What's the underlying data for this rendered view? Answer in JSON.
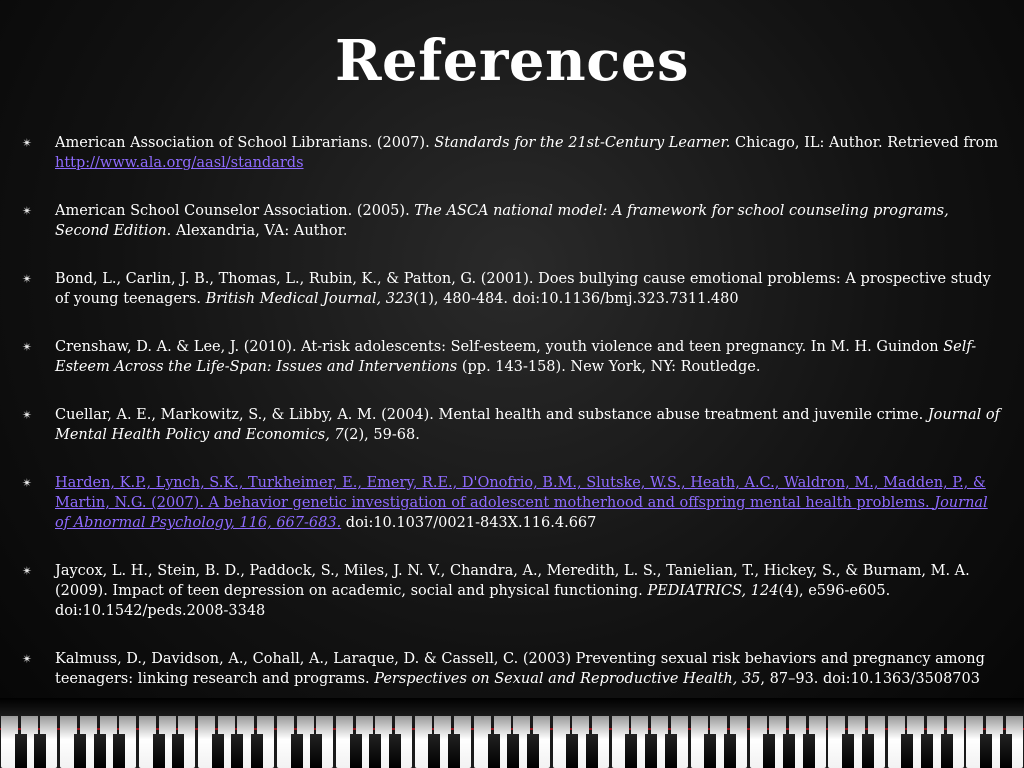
{
  "title": "References",
  "references": [
    {
      "segments": [
        {
          "text": "American Association of School Librarians. (2007). "
        },
        {
          "text": "Standards for the 21st-Century Learner.",
          "italic": true
        },
        {
          "text": " Chicago, IL: Author. Retrieved from "
        },
        {
          "text": "http://www.ala.org/aasl/standards",
          "link": true
        }
      ]
    },
    {
      "segments": [
        {
          "text": "American School Counselor Association. (2005). "
        },
        {
          "text": "The ASCA national model: A framework for school counseling programs, Second Edition",
          "italic": true
        },
        {
          "text": ". Alexandria, VA: Author."
        }
      ]
    },
    {
      "segments": [
        {
          "text": "Bond, L., Carlin, J. B., Thomas, L., Rubin, K., & Patton, G. (2001). Does bullying cause emotional problems: A prospective study of young teenagers. "
        },
        {
          "text": "British Medical Journal, 323",
          "italic": true
        },
        {
          "text": "(1), 480-484. doi:10.1136/bmj.323.7311.480"
        }
      ]
    },
    {
      "segments": [
        {
          "text": "Crenshaw, D. A. & Lee, J. (2010). At-risk adolescents: Self-esteem, youth violence and teen pregnancy. In M. H. Guindon "
        },
        {
          "text": "Self-Esteem Across the Life-Span: Issues and Interventions",
          "italic": true
        },
        {
          "text": " (pp. 143-158). New York, NY: Routledge."
        }
      ]
    },
    {
      "segments": [
        {
          "text": "Cuellar, A. E., Markowitz, S., & Libby, A. M. (2004). Mental health and substance abuse treatment and juvenile crime. "
        },
        {
          "text": "Journal of Mental Health Policy and Economics, 7",
          "italic": true
        },
        {
          "text": "(2), 59-68."
        }
      ]
    },
    {
      "segments": [
        {
          "text": "Harden, K.P., Lynch, S.K., Turkheimer, E., Emery, R.E., D'Onofrio, B.M., Slutske, W.S., Heath, A.C., Waldron, M., Madden, P., & Martin, N.G. (2007). A behavior genetic investigation of adolescent motherhood and offspring mental health problems. ",
          "link": true
        },
        {
          "text": "Journal of Abnormal Psychology, 116, 667-683.",
          "link": true,
          "italic": true
        },
        {
          "text": " doi:10.1037/0021-843X.116.4.667"
        }
      ]
    },
    {
      "segments": [
        {
          "text": "Jaycox, L. H., Stein, B. D., Paddock, S., Miles, J. N. V., Chandra, A., Meredith, L. S., Tanielian, T., Hickey, S., & Burnam, M. A. (2009). Impact of teen depression on academic, social and physical functioning. "
        },
        {
          "text": "PEDIATRICS, 124",
          "italic": true
        },
        {
          "text": "(4), e596-e605. doi:10.1542/peds.2008-3348"
        }
      ]
    },
    {
      "segments": [
        {
          "text": "Kalmuss, D., Davidson, A., Cohall, A., Laraque, D. & Cassell, C. (2003) Preventing sexual risk behaviors and pregnancy among teenagers: linking research and programs. "
        },
        {
          "text": "Perspectives on Sexual and Reproductive Health, 35",
          "italic": true
        },
        {
          "text": ", 87–93. doi:10.1363/3508703"
        }
      ]
    }
  ],
  "colors": {
    "link": "#8f6bff",
    "text": "#ffffff",
    "background": "#121212"
  },
  "icons": {
    "bullet": "sparkle-bullet-icon",
    "footer": "piano-keys-decoration"
  }
}
